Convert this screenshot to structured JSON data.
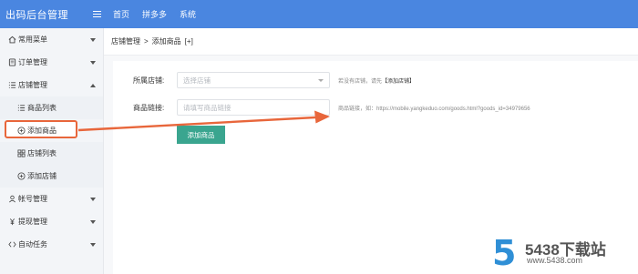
{
  "app": {
    "title": "出码后台管理"
  },
  "topnav": {
    "items": [
      "首页",
      "拼多多",
      "系统"
    ]
  },
  "sidebar": {
    "items": [
      {
        "label": "常用菜单",
        "icon": "home-icon"
      },
      {
        "label": "订单管理",
        "icon": "order-icon"
      },
      {
        "label": "店铺管理",
        "icon": "list-icon"
      },
      {
        "label": "商品列表",
        "icon": "list-icon"
      },
      {
        "label": "添加商品",
        "icon": "plus-circle-icon"
      },
      {
        "label": "店铺列表",
        "icon": "grid-icon"
      },
      {
        "label": "添加店铺",
        "icon": "plus-circle-icon"
      },
      {
        "label": "帐号管理",
        "icon": "user-icon"
      },
      {
        "label": "提现管理",
        "icon": "money-icon"
      },
      {
        "label": "自动任务",
        "icon": "code-icon"
      }
    ]
  },
  "breadcrumb": {
    "parent": "店铺管理",
    "separator": ">",
    "current": "添加商品",
    "tag": "[+]"
  },
  "form": {
    "shop_label": "所属店铺:",
    "shop_placeholder": "选择店铺",
    "shop_hint": "若没有店铺，请先",
    "shop_hint_link": "【添加店铺】",
    "link_label": "商品链接:",
    "link_placeholder": "请填写商品链接",
    "link_hint": "商品链接，如：https://mobile.yangkeduo.com/goods.html?goods_id=34979656",
    "submit_label": "添加商品"
  },
  "watermark": {
    "digit": "5",
    "name": "5438下载站",
    "url": "www.5438.com"
  },
  "colors": {
    "topbar": "#4a86e0",
    "accent_button": "#3aa58f",
    "highlight": "#e8663b",
    "watermark_blue": "#2f8fd6"
  }
}
